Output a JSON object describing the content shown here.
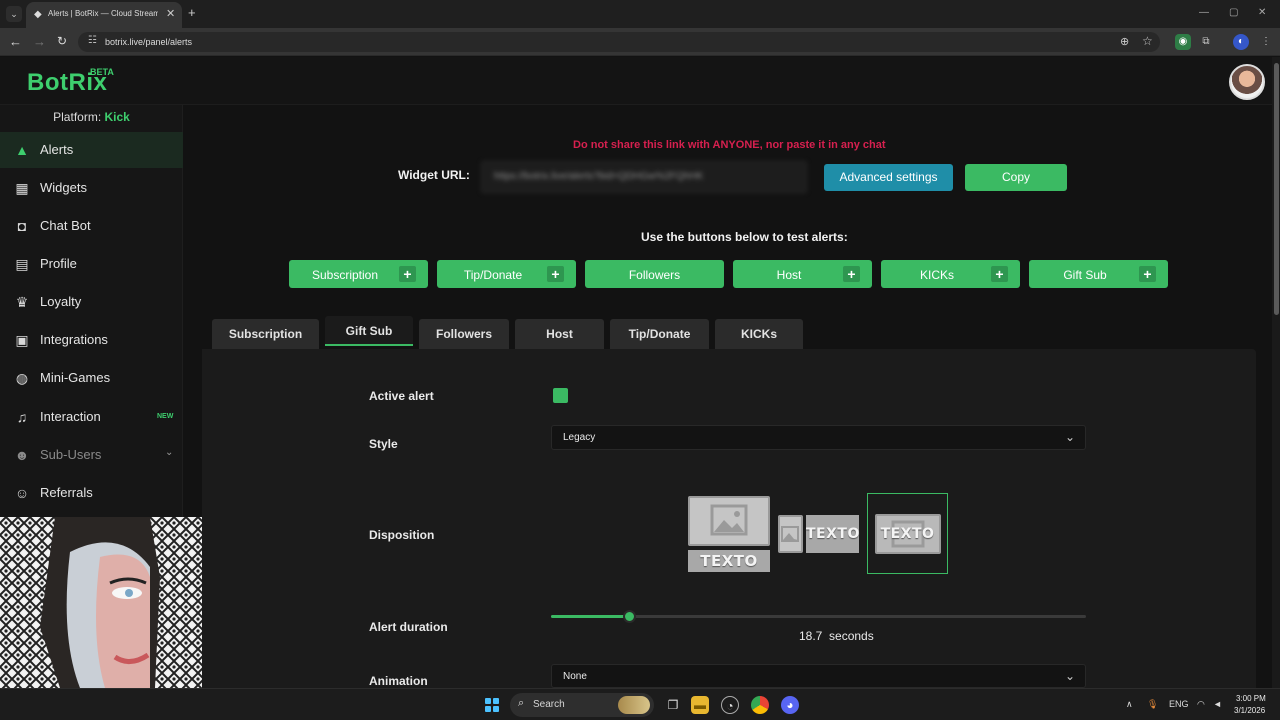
{
  "browser": {
    "tab_title": "Alerts | BotRix — Cloud Streami",
    "url": "botrix.live/panel/alerts"
  },
  "app": {
    "logo": "BotRix",
    "logo_badge": "BETA",
    "platform_label": "Platform:",
    "platform_value": "Kick"
  },
  "sidebar": {
    "items": [
      {
        "label": "Alerts",
        "icon": "warning-triangle-icon",
        "active": true
      },
      {
        "label": "Widgets",
        "icon": "grid-icon"
      },
      {
        "label": "Chat Bot",
        "icon": "robot-icon"
      },
      {
        "label": "Profile",
        "icon": "id-card-icon"
      },
      {
        "label": "Loyalty",
        "icon": "trophy-icon"
      },
      {
        "label": "Integrations",
        "icon": "plug-icon"
      },
      {
        "label": "Mini-Games",
        "icon": "gamepad-icon"
      },
      {
        "label": "Interaction",
        "icon": "music-note-icon",
        "badge": "NEW"
      },
      {
        "label": "Sub-Users",
        "icon": "users-icon",
        "disabled": true
      },
      {
        "label": "Referrals",
        "icon": "user-group-icon"
      }
    ]
  },
  "widget": {
    "warning": "Do not share this link with ANYONE, nor paste it in any chat",
    "label": "Widget URL:",
    "url_value": "https://botrix.live/alerts?bid=QDHGw%2FQhHK",
    "advanced_label": "Advanced settings",
    "copy_label": "Copy"
  },
  "test": {
    "heading": "Use the buttons below to test alerts:",
    "buttons": [
      {
        "label": "Subscription",
        "plus": true
      },
      {
        "label": "Tip/Donate",
        "plus": true
      },
      {
        "label": "Followers",
        "plus": false
      },
      {
        "label": "Host",
        "plus": true
      },
      {
        "label": "KICKs",
        "plus": true
      },
      {
        "label": "Gift Sub",
        "plus": true
      }
    ]
  },
  "tabs": [
    {
      "label": "Subscription"
    },
    {
      "label": "Gift Sub",
      "active": true
    },
    {
      "label": "Followers"
    },
    {
      "label": "Host"
    },
    {
      "label": "Tip/Donate"
    },
    {
      "label": "KICKs"
    }
  ],
  "form": {
    "active_alert_label": "Active alert",
    "active_alert_checked": true,
    "style_label": "Style",
    "style_value": "Legacy",
    "disposition_label": "Disposition",
    "disposition_text": "TEXTO",
    "disposition_selected": 3,
    "duration_label": "Alert duration",
    "duration_value": "18.7",
    "duration_unit": "seconds",
    "duration_fraction": 0.148,
    "animation_label": "Animation",
    "animation_value": "None"
  },
  "taskbar": {
    "search_label": "Search",
    "lang": "ENG",
    "time": "3:00 PM",
    "date": "3/1/2026"
  },
  "colors": {
    "accent": "#3bba63",
    "info": "#1f8ea8",
    "warning": "#d6204f"
  }
}
